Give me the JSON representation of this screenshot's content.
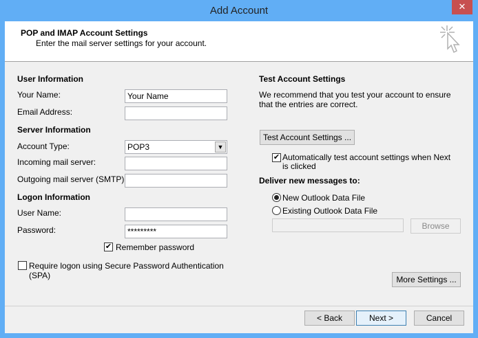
{
  "window": {
    "title": "Add Account",
    "close": "✕"
  },
  "header": {
    "title": "POP and IMAP Account Settings",
    "subtitle": "Enter the mail server settings for your account."
  },
  "left": {
    "user_info": "User Information",
    "your_name_label": "Your Name:",
    "your_name_value": "Your Name",
    "email_label": "Email Address:",
    "email_value": "",
    "server_info": "Server Information",
    "account_type_label": "Account Type:",
    "account_type_value": "POP3",
    "incoming_label": "Incoming mail server:",
    "outgoing_label": "Outgoing mail server (SMTP):",
    "logon_info": "Logon Information",
    "username_label": "User Name:",
    "password_label": "Password:",
    "password_value": "*********",
    "remember_label": "Remember password",
    "remember_checked": true,
    "spa_label": "Require logon using Secure Password Authentication (SPA)",
    "spa_checked": false
  },
  "right": {
    "test_title": "Test Account Settings",
    "test_desc": "We recommend that you test your account to ensure that the entries are correct.",
    "test_button": "Test Account Settings ...",
    "auto_test_label": "Automatically test account settings when Next is clicked",
    "auto_test_checked": true,
    "deliver_title": "Deliver new messages to:",
    "new_file": "New Outlook Data File",
    "existing_file": "Existing Outlook Data File",
    "selected": "New Outlook Data File",
    "browse": "Browse",
    "more_settings": "More Settings ..."
  },
  "footer": {
    "back": "< Back",
    "next": "Next >",
    "cancel": "Cancel"
  }
}
